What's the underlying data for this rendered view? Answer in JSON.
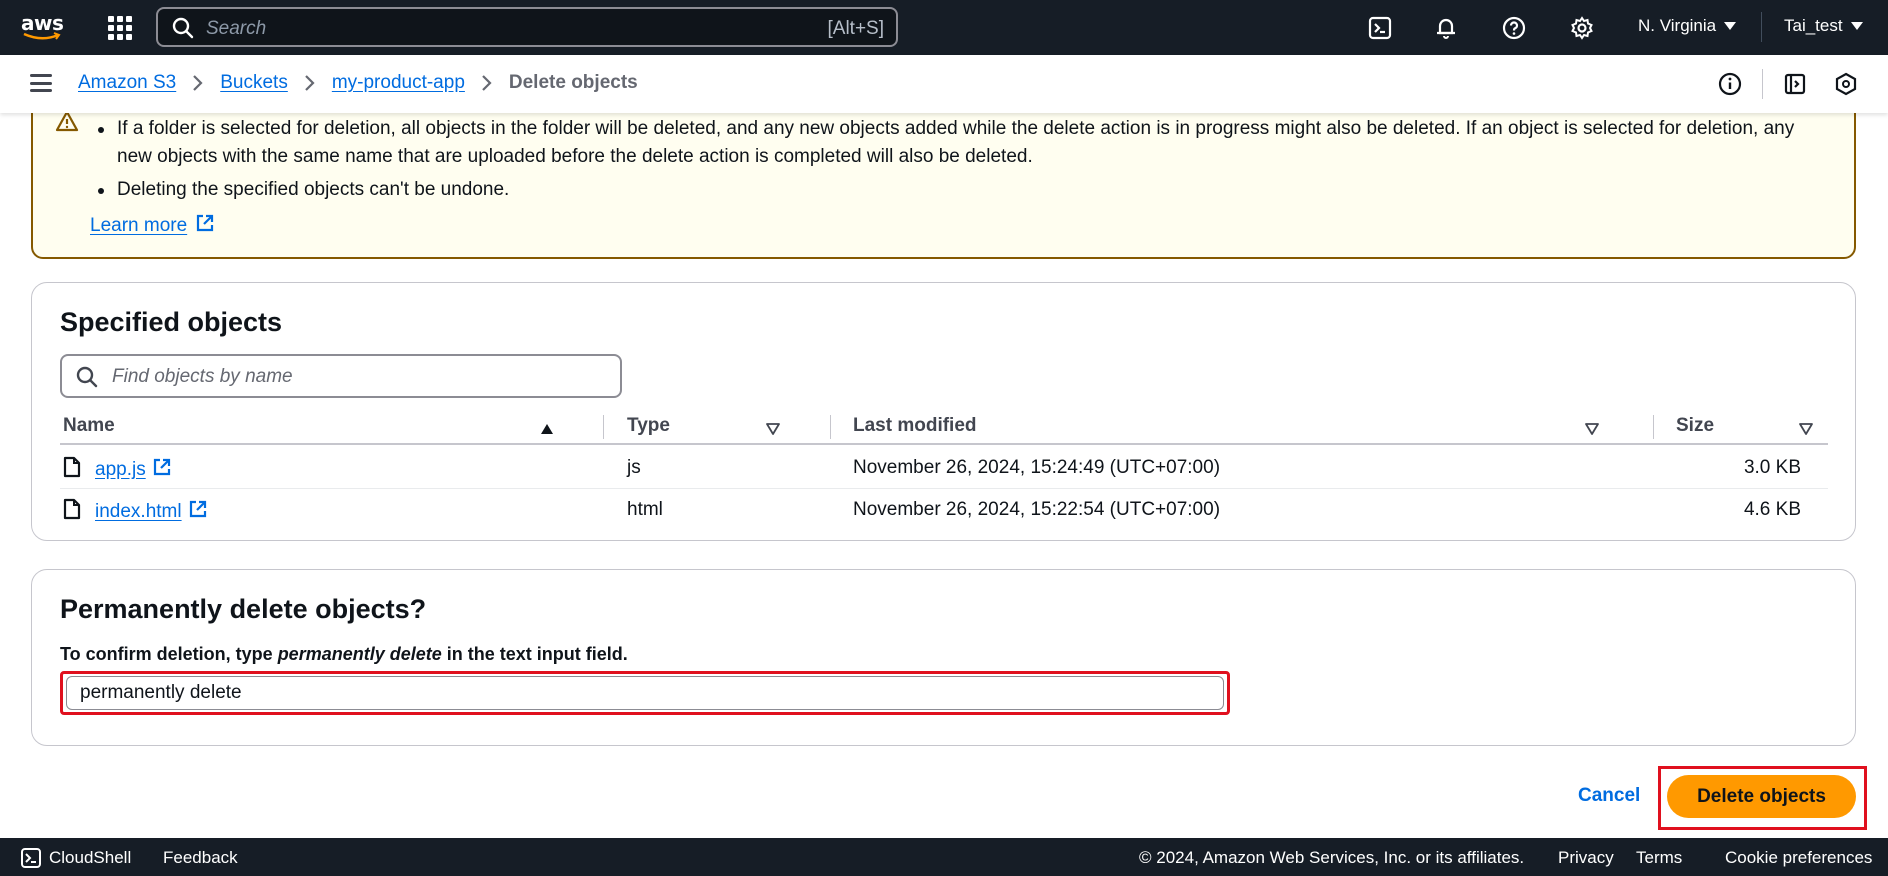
{
  "topnav": {
    "logo_text": "aws",
    "search_placeholder": "Search",
    "search_shortcut": "[Alt+S]",
    "region": "N. Virginia",
    "account": "Tai_test",
    "icons": [
      "services-grid-icon",
      "search-icon",
      "cloudshell-icon",
      "bell-icon",
      "help-icon",
      "gear-icon"
    ]
  },
  "breadcrumb": {
    "items": [
      "Amazon S3",
      "Buckets",
      "my-product-app"
    ],
    "current": "Delete objects"
  },
  "warning": {
    "bullets": [
      "If a folder is selected for deletion, all objects in the folder will be deleted, and any new objects added while the delete action is in progress might also be deleted. If an object is selected for deletion, any new objects with the same name that are uploaded before the delete action is completed will also be deleted.",
      "Deleting the specified objects can't be undone."
    ],
    "learn_more": "Learn more"
  },
  "specified": {
    "title": "Specified objects",
    "search_placeholder": "Find objects by name",
    "columns": [
      "Name",
      "Type",
      "Last modified",
      "Size"
    ],
    "rows": [
      {
        "name": "app.js",
        "type": "js",
        "last_modified": "November 26, 2024, 15:24:49 (UTC+07:00)",
        "size": "3.0 KB"
      },
      {
        "name": "index.html",
        "type": "html",
        "last_modified": "November 26, 2024, 15:22:54 (UTC+07:00)",
        "size": "4.6 KB"
      }
    ]
  },
  "confirm": {
    "title": "Permanently delete objects?",
    "label_prefix": "To confirm deletion, type ",
    "label_em": "permanently delete",
    "label_suffix": " in the text input field.",
    "value": "permanently delete"
  },
  "actions": {
    "cancel": "Cancel",
    "delete": "Delete objects"
  },
  "footer": {
    "cloudshell": "CloudShell",
    "feedback": "Feedback",
    "copyright": "© 2024, Amazon Web Services, Inc. or its affiliates.",
    "privacy": "Privacy",
    "terms": "Terms",
    "cookies": "Cookie preferences"
  },
  "colors": {
    "nav_bg": "#161d26",
    "link": "#006ce0",
    "primary_button": "#ff9900",
    "warning_bg": "#fffef0",
    "warning_border": "#855900",
    "highlight": "#e0101e"
  }
}
